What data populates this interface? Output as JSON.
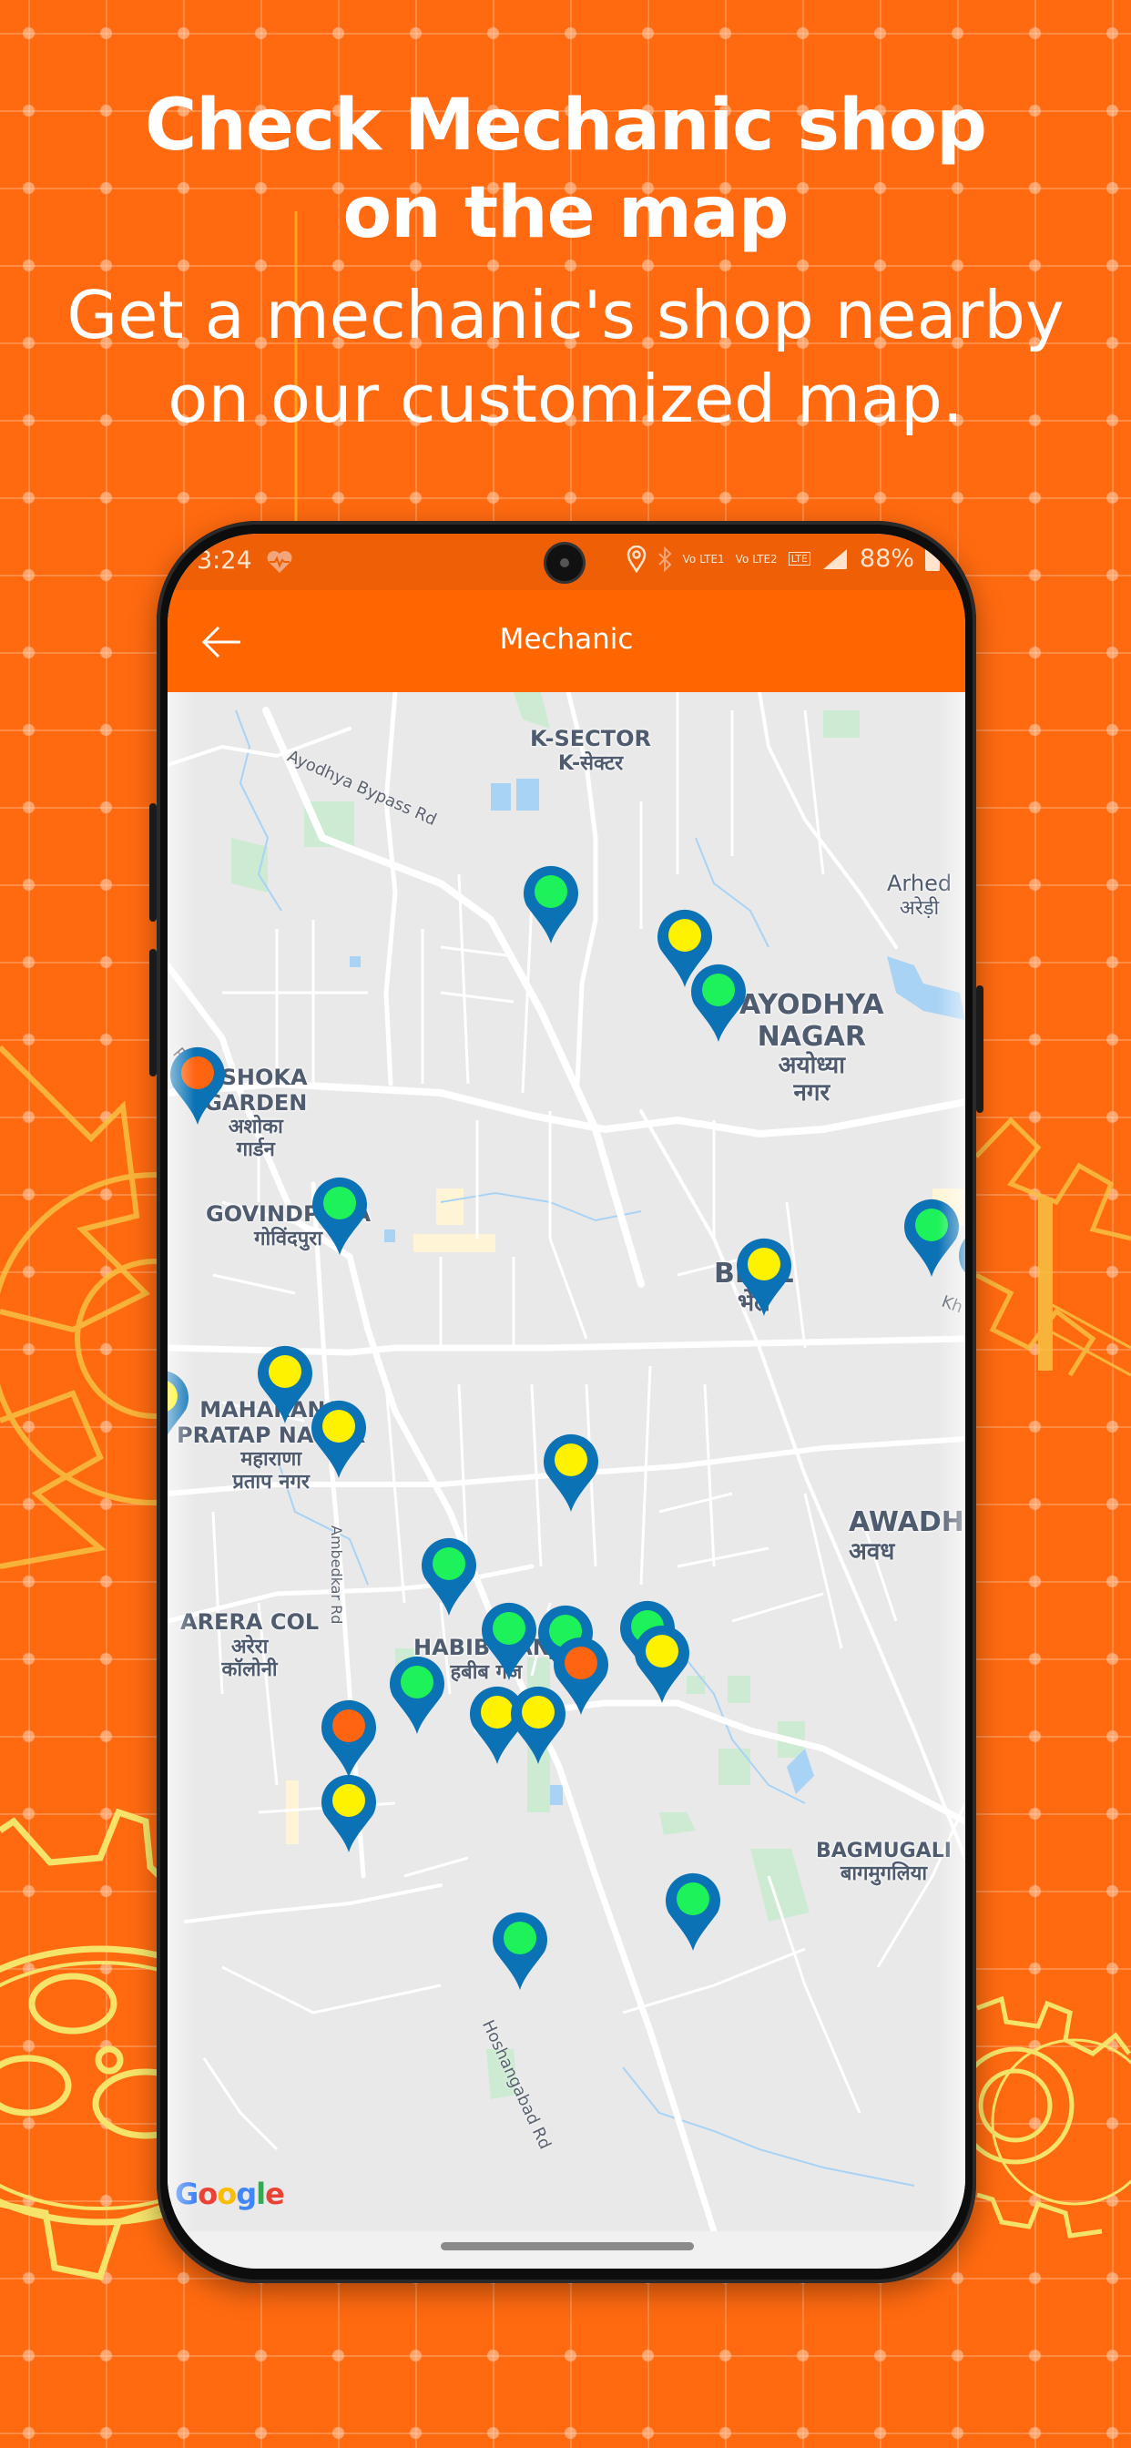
{
  "promo": {
    "title_line1": "Check Mechanic shop",
    "title_line2": "on the map",
    "subtitle_line1": "Get a mechanic's shop nearby",
    "subtitle_line2": "on our customized map."
  },
  "status_bar": {
    "time": "3:24",
    "battery": "88%",
    "sim1": "Vo LTE1",
    "sim2": "Vo LTE2",
    "network": "LTE",
    "icons": [
      "heart-rate-icon",
      "location-icon",
      "bluetooth-icon",
      "signal-icon",
      "battery-icon"
    ]
  },
  "app_bar": {
    "title": "Mechanic",
    "back_icon": "arrow-left-icon"
  },
  "colors": {
    "background": "#FF6A10",
    "app_bar": "#FF6600",
    "pin_body": "#0A72B5",
    "pin_green": "#1EF25A",
    "pin_yellow": "#FFF200",
    "pin_orange": "#FF6410",
    "user_dot": "#4285F4"
  },
  "map": {
    "attribution": "Google",
    "area_labels": [
      {
        "en": "K-SECTOR",
        "hi": "K-सेक्टर"
      },
      {
        "en": "Arhed",
        "hi": "अरेड़ी"
      },
      {
        "en": "AYODHYA NAGAR",
        "hi": "अयोध्या नगर"
      },
      {
        "en": "ASHOKA GARDEN",
        "hi": "अशोका गार्डन"
      },
      {
        "en": "GOVINDPURA",
        "hi": "गोविंदपुरा"
      },
      {
        "en": "BHEL",
        "hi": "भेल"
      },
      {
        "en": "MAHARANA PRATAP NAGAR",
        "hi": "महाराणा प्रताप नगर"
      },
      {
        "en": "AWADH",
        "hi": "अवध"
      },
      {
        "en": "ARERA COL",
        "hi": "अरेरा कॉलोनी"
      },
      {
        "en": "HABIB GANJ",
        "hi": "हबीब गंज"
      },
      {
        "en": "BAGMUGALI",
        "hi": "बागमुगलिया"
      }
    ],
    "road_labels": [
      "Ayodhya Bypass Rd",
      "Ambedkar Rd",
      "Hoshangabad Rd",
      "Rd",
      "Kh"
    ],
    "pins": [
      {
        "status": "green"
      },
      {
        "status": "yellow"
      },
      {
        "status": "green"
      },
      {
        "status": "orange"
      },
      {
        "status": "green"
      },
      {
        "status": "green"
      },
      {
        "status": "yellow"
      },
      {
        "status": "yellow"
      },
      {
        "status": "yellow"
      },
      {
        "status": "yellow"
      },
      {
        "status": "yellow"
      },
      {
        "status": "green"
      },
      {
        "status": "green"
      },
      {
        "status": "green"
      },
      {
        "status": "green"
      },
      {
        "status": "yellow"
      },
      {
        "status": "orange"
      },
      {
        "status": "green"
      },
      {
        "status": "yellow"
      },
      {
        "status": "yellow"
      },
      {
        "status": "orange"
      },
      {
        "status": "yellow"
      },
      {
        "status": "green"
      },
      {
        "status": "green"
      },
      {
        "status": "yellow"
      }
    ]
  }
}
